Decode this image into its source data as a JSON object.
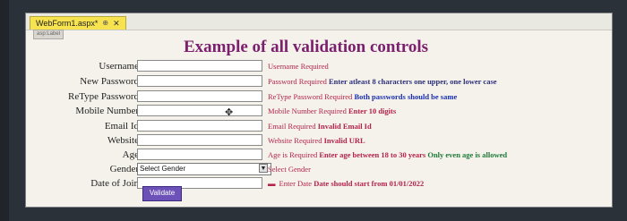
{
  "tab": {
    "title": "WebForm1.aspx*",
    "pin_icon": "pin-icon",
    "close_symbol": "✕"
  },
  "design_tag": "asp:Label",
  "page": {
    "heading": "Example of all validation controls"
  },
  "form": {
    "rows": [
      {
        "label": "Username",
        "messages": [
          "Username Required"
        ]
      },
      {
        "label": "New Password",
        "messages": [
          "Password Required",
          "Enter atleast 8 characters one upper, one lower case"
        ]
      },
      {
        "label": "ReType Password",
        "messages": [
          "ReType Password Required",
          "Both passwords should be same"
        ]
      },
      {
        "label": "Mobile Number",
        "messages": [
          "Mobile Number Required",
          "Enter 10 digits"
        ]
      },
      {
        "label": "Email Id",
        "messages": [
          "Email Required",
          "Invalid Email Id"
        ]
      },
      {
        "label": "Website",
        "messages": [
          "Website Required",
          "Invalid URL"
        ]
      },
      {
        "label": "Age",
        "messages": [
          "Age is Required",
          "Enter age between 18 to 30 years",
          "Only even age is allowed"
        ]
      },
      {
        "label": "Gender",
        "select_value": "Select Gender",
        "messages": [
          "Select Gender"
        ]
      },
      {
        "label": "Date of Join",
        "messages": [
          "Enter Date",
          "Date should start from 01/01/2022"
        ]
      }
    ],
    "validate_label": "Validate"
  },
  "colors": {
    "heading": "#7b1f6e",
    "required_msg": "#b4234a",
    "compare_msg": "#1a2fb0",
    "green_msg": "#1f7a3a",
    "button_bg": "#6c52b8"
  }
}
